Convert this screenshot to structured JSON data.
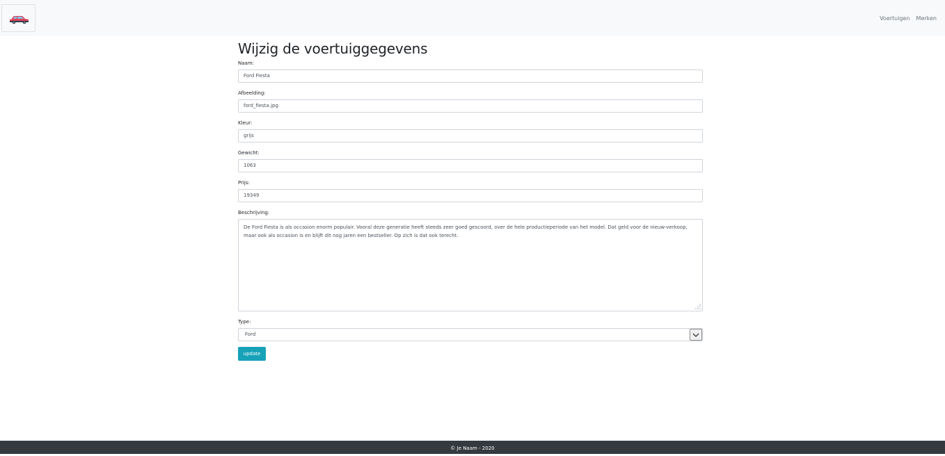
{
  "navbar": {
    "logo_icon": "car-icon",
    "links": [
      "Voertuigen",
      "Merken"
    ]
  },
  "page": {
    "title": "Wijzig de voertuiggegevens"
  },
  "form": {
    "naam_label": "Naam:",
    "naam_value": "Ford Fiesta",
    "afbeelding_label": "Afbeelding:",
    "afbeelding_value": "ford_fiesta.jpg",
    "kleur_label": "Kleur:",
    "kleur_value": "grijs",
    "gewicht_label": "Gewicht:",
    "gewicht_value": "1063",
    "prijs_label": "Prijs:",
    "prijs_value": "19349",
    "beschrijving_label": "Beschrijving:",
    "beschrijving_value": "De Ford Fiesta is als occasion enorm populair. Vooral deze generatie heeft steeds zeer goed gescoord, over de hele productieperiode van het model. Dat geld voor de nieuw-verkoop, maar ook als occasion is en blijft dit nog jaren een bestseller. Op zich is dat ook terecht.",
    "type_label": "Type:",
    "type_value": "Ford",
    "submit_label": "update"
  },
  "footer": {
    "text": "© Je Naam - 2020"
  },
  "colors": {
    "navbar_bg": "#f8f9fa",
    "button_bg": "#17a2b8",
    "footer_bg": "#343a40"
  }
}
